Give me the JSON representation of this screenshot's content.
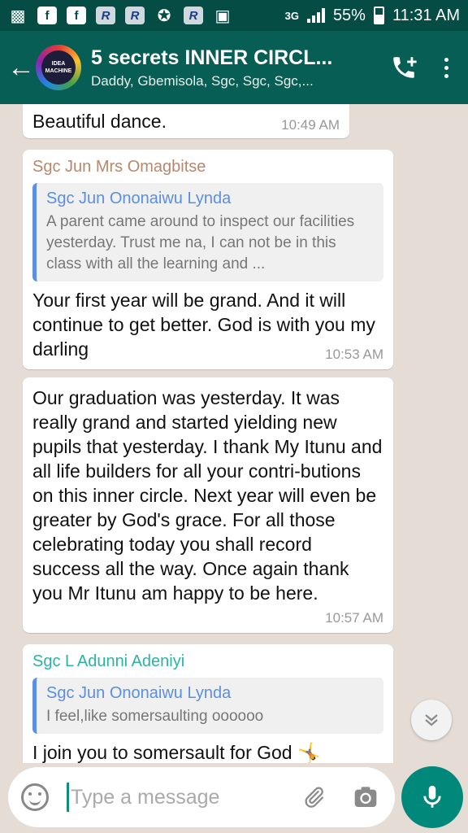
{
  "status_bar": {
    "network": "3G",
    "battery": "55%",
    "time": "11:31 AM"
  },
  "header": {
    "back_icon": "arrow-left",
    "avatar_text": "IDEA MACHINE",
    "title": "5 secrets INNER CIRCL...",
    "subtitle": "Daddy, Gbemisola, Sgc, Sgc, Sgc,..."
  },
  "messages": [
    {
      "text": "Beautiful dance.",
      "time": "10:49 AM"
    },
    {
      "sender": "Sgc Jun Mrs Omagbitse",
      "sender_color": "#b5896e",
      "quote_author": "Sgc Jun Ononaiwu Lynda",
      "quote_text": "A parent came around to inspect our facilities yesterday. Trust me na, I can not be in this class with all the learning and ...",
      "text": "Your first year will be grand. And it will continue to get better. God is with you my darling",
      "time": "10:53 AM"
    },
    {
      "text": "Our graduation was yesterday. It was really grand and started yielding new pupils that yesterday. I thank My Itunu and all life builders for all your contri-butions on this inner circle. Next year will even be greater by God's grace. For all those celebrating today you shall record success all the way. Once again thank you Mr Itunu am happy to be here.",
      "time": "10:57 AM"
    },
    {
      "sender": "Sgc L Adunni Adeniyi",
      "sender_color": "#2bb3a5",
      "quote_author": "Sgc Jun Ononaiwu Lynda",
      "quote_text": "I feel,like somersaulting oooooo",
      "text": "I join you to somersault for God 🤸"
    }
  ],
  "input": {
    "placeholder": "Type a message"
  },
  "colors": {
    "header": "#075e54",
    "status_bar": "#054d44",
    "accent": "#00897b",
    "quote_bar": "#5b8fe0"
  }
}
